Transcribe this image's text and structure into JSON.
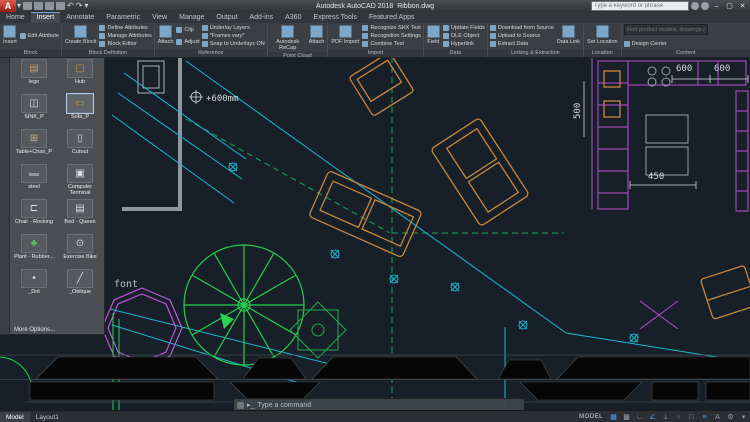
{
  "title_bar": {
    "app_glyph": "A",
    "app": "Autodesk AutoCAD 2018",
    "doc": "Ribbon.dwg",
    "search_placeholder": "Type a keyword or phrase",
    "undo_glyph": "↶",
    "redo_glyph": "↷",
    "win": {
      "min": "–",
      "max": "▢",
      "close": "✕"
    }
  },
  "tabs": {
    "items": [
      "Home",
      "Insert",
      "Annotate",
      "Parametric",
      "View",
      "Manage",
      "Output",
      "Add-ins",
      "A360",
      "Express Tools",
      "Featured Apps"
    ]
  },
  "ribbon": {
    "block": {
      "label": "Block",
      "big": "Insert",
      "item0": "Edit Attribute"
    },
    "blockdef": {
      "label": "Block Definition",
      "big": "Create Block",
      "items": [
        "Define Attributes",
        "Manage Attributes",
        "Block Editor"
      ]
    },
    "reference": {
      "label": "Reference",
      "big": "Attach",
      "col1": [
        "Clip",
        "Adjust"
      ],
      "col2": [
        "Underlay Layers",
        "*Frames vary*",
        "Snap to Underlays ON"
      ]
    },
    "pointcloud": {
      "label": "Point Cloud",
      "big0": "Autodesk ReCap",
      "big1": "Attach"
    },
    "import": {
      "label": "Import",
      "big": "PDF Import",
      "items": [
        "Recognize SHX Text",
        "Recognition Settings",
        "Combine Text"
      ]
    },
    "data": {
      "label": "Data",
      "big": "Field",
      "items": [
        "Update Fields",
        "OLE Object",
        "Hyperlink"
      ]
    },
    "linking": {
      "label": "Linking & Extraction",
      "big": "Data Link",
      "items": [
        "Download from Source",
        "Upload to Source",
        "Extract Data"
      ]
    },
    "location": {
      "label": "Location",
      "big": "Set Location"
    },
    "content": {
      "label": "Content",
      "search_placeholder": "Find product models, drawings and specs",
      "item": "Design Center"
    }
  },
  "palette": {
    "items": [
      {
        "label": "lego",
        "glyph": "▤",
        "color": "#c49a6c"
      },
      {
        "label": "Hub",
        "glyph": "▢",
        "color": "#d29a4a"
      },
      {
        "label": "SINK_P",
        "glyph": "◫",
        "color": "#d9dde0"
      },
      {
        "label": "Sofa_P",
        "glyph": "▭",
        "color": "#d29a4a"
      },
      {
        "label": "Table+Chair_P",
        "glyph": "⊞",
        "color": "#cdb48e"
      },
      {
        "label": "Cutout",
        "glyph": "▯",
        "color": "#d9dde0"
      },
      {
        "label": "steel",
        "glyph": "▬",
        "color": "#93979b"
      },
      {
        "label": "Computer Terminal",
        "glyph": "▣",
        "color": "#d9dde0"
      },
      {
        "label": "Chair - Rocking",
        "glyph": "⊏",
        "color": "#d9dde0"
      },
      {
        "label": "Bed - Queen",
        "glyph": "▤",
        "color": "#d9dde0"
      },
      {
        "label": "Plant - Rubber...",
        "glyph": "♣",
        "color": "#57c06a"
      },
      {
        "label": "Exercise Bike",
        "glyph": "⊙",
        "color": "#d9dde0"
      },
      {
        "label": "_Dot",
        "glyph": "•",
        "color": "#d9dde0"
      },
      {
        "label": "_Oblique",
        "glyph": "╱",
        "color": "#d9dde0"
      }
    ],
    "more": "More Options..."
  },
  "canvas": {
    "plus600": "+600mm",
    "font_label": "font",
    "dim450": "450",
    "dim500": "500",
    "dim600a": "600",
    "dim600b": "600",
    "accent_cyan": "#1bb8cd",
    "accent_green": "#27cf4d",
    "accent_orange": "#c8873c",
    "accent_magenta": "#bb4fd0"
  },
  "command": {
    "caret": "▸_",
    "prompt": "Type a command"
  },
  "status": {
    "tabs": [
      "Model",
      "Layout1"
    ],
    "model_label": "MODEL",
    "icons": [
      "▦",
      "▩",
      "∟",
      "∠",
      "⊥",
      "○",
      "□",
      "≡",
      "A",
      "⚙",
      "▾"
    ]
  }
}
